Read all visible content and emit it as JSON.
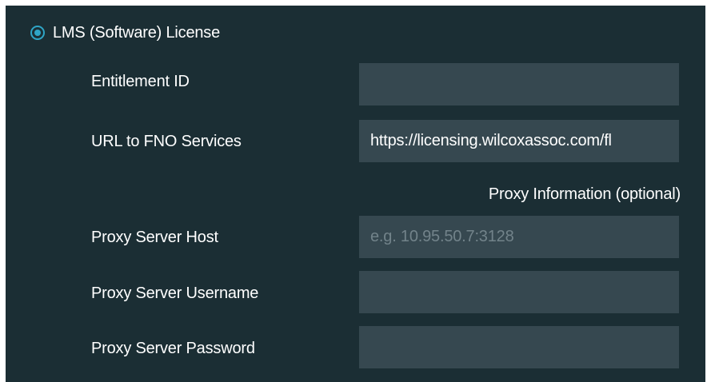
{
  "license_option": {
    "label": "LMS (Software) License",
    "selected": true,
    "accent_color": "#2fa5c6"
  },
  "fields": {
    "entitlement_id": {
      "label": "Entitlement ID",
      "value": "",
      "placeholder": ""
    },
    "fno_url": {
      "label": "URL to FNO Services",
      "value": "https://licensing.wilcoxassoc.com/fl",
      "placeholder": ""
    },
    "proxy_section_label": "Proxy Information (optional)",
    "proxy_host": {
      "label": "Proxy Server Host",
      "value": "",
      "placeholder": "e.g. 10.95.50.7:3128"
    },
    "proxy_username": {
      "label": "Proxy Server Username",
      "value": "",
      "placeholder": ""
    },
    "proxy_password": {
      "label": "Proxy Server Password",
      "value": "",
      "placeholder": ""
    }
  },
  "colors": {
    "panel_background": "#1b2e34",
    "field_background": "#364850",
    "text": "#ffffff",
    "placeholder": "#72838a"
  }
}
